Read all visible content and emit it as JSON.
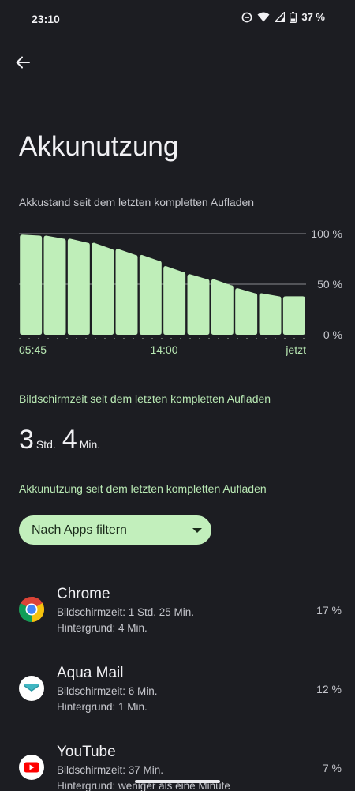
{
  "status": {
    "time": "23:10",
    "battery_percent": "37 %"
  },
  "page": {
    "title": "Akkunutzung",
    "chart_caption": "Akkustand seit dem letzten kompletten Aufladen"
  },
  "chart_data": {
    "type": "bar",
    "values": [
      99,
      98,
      95,
      91,
      85,
      79,
      68,
      60,
      55,
      46,
      41,
      38
    ],
    "ylim": [
      0,
      100
    ],
    "y_ticks": [
      "100 %",
      "50 %",
      "0 %"
    ],
    "x_ticks": [
      "05:45",
      "14:00",
      "jetzt"
    ],
    "bar_color": "#bfeeb9",
    "grid": true
  },
  "screen_time": {
    "label": "Bildschirmzeit seit dem letzten kompletten Aufladen",
    "hours_value": "3",
    "hours_unit": "Std.",
    "minutes_value": "4",
    "minutes_unit": "Min."
  },
  "usage": {
    "label": "Akkunutzung seit dem letzten kompletten Aufladen",
    "filter_label": "Nach Apps filtern"
  },
  "apps": [
    {
      "name": "Chrome",
      "screen_time": "Bildschirmzeit: 1 Std. 25 Min.",
      "background": "Hintergrund: 4 Min.",
      "percent": "17 %",
      "icon": "chrome-icon"
    },
    {
      "name": "Aqua Mail",
      "screen_time": "Bildschirmzeit: 6 Min.",
      "background": "Hintergrund: 1 Min.",
      "percent": "12 %",
      "icon": "aqua-mail-icon"
    },
    {
      "name": "YouTube",
      "screen_time": "Bildschirmzeit: 37 Min.",
      "background": "Hintergrund: weniger als eine Minute",
      "percent": "7 %",
      "icon": "youtube-icon"
    }
  ],
  "colors": {
    "background": "#1c1d22",
    "accent_green": "#b8e8b3",
    "chip_green": "#c2efbc"
  }
}
